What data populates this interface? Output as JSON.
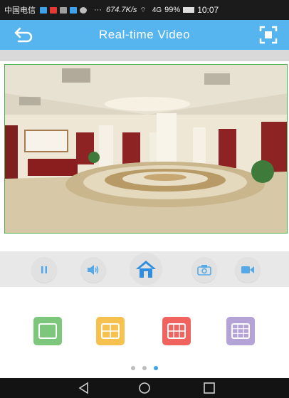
{
  "status_bar": {
    "carrier": "中国电信",
    "notification_dots": "···",
    "net_speed": "674.7K/s",
    "signal_text": "4G",
    "battery": "99%",
    "time": "10:07"
  },
  "header": {
    "title": "Real-time Video",
    "back_icon": "back-arrow-icon",
    "fullscreen_icon": "fullscreen-icon"
  },
  "controls": [
    {
      "name": "pause-button",
      "icon": "pause-icon"
    },
    {
      "name": "audio-button",
      "icon": "speaker-icon"
    },
    {
      "name": "home-button",
      "icon": "home-icon"
    },
    {
      "name": "snapshot-button",
      "icon": "camera-icon"
    },
    {
      "name": "record-button",
      "icon": "video-camera-icon"
    }
  ],
  "layouts": [
    {
      "name": "layout-single",
      "color": "#7cc77b"
    },
    {
      "name": "layout-quad",
      "color": "#f7c14f"
    },
    {
      "name": "layout-six",
      "color": "#f0635e"
    },
    {
      "name": "layout-nine",
      "color": "#b4a3d6"
    }
  ],
  "pager": {
    "count": 3,
    "active": 3
  },
  "colors": {
    "accent": "#56b4ef",
    "status_bar": "#1b1b1b",
    "nav_bar": "#131313"
  }
}
